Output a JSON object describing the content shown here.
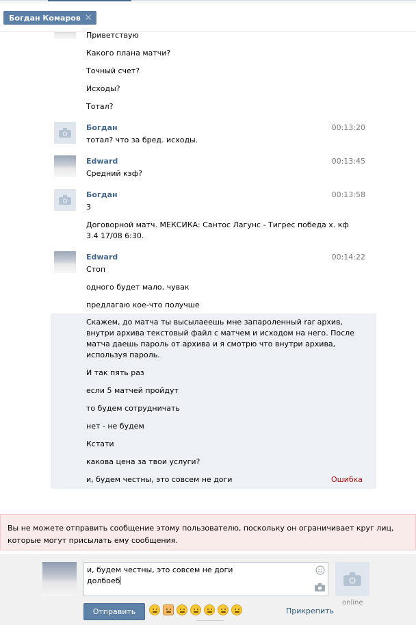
{
  "tab": {
    "title": "Богдан Комаров",
    "close": "✕"
  },
  "messages": [
    {
      "lines": [
        "Приветствую",
        "Какого плана матчи?",
        "Точный счет?",
        "Исходы?",
        "Тотал?"
      ]
    },
    {
      "author": "Богдан",
      "time": "00:13:20",
      "avatar": "camera",
      "lines": [
        "тотал? что за бред. исходы."
      ]
    },
    {
      "author": "Edward",
      "time": "00:13:45",
      "avatar": "photo",
      "lines": [
        "Средний кэф?"
      ]
    },
    {
      "author": "Богдан",
      "time": "00:13:58",
      "avatar": "camera",
      "lines": [
        "3",
        "Договорной матч. МЕКСИКА: Сантос Лагунс - Тигрес победа х. кф",
        "3.4 17/08 6:30."
      ]
    },
    {
      "author": "Edward",
      "time": "00:14:22",
      "avatar": "photo",
      "lines": [
        "Стоп",
        "одного будет мало, чувак",
        "предлагаю кое-что получше"
      ]
    },
    {
      "unread": true,
      "lines": [
        "Скажем, до матча ты высылаеешь мне запароленный rar архив,",
        "внутри архива текстовый файл с матчем и исходом на него. После",
        "матча даешь пароль от архива и я смотрю что внутри архива,",
        "используя пароль.",
        "И так пять раз",
        "если 5 матчей пройдут",
        "то будем сотрудничать",
        "нет - не будем",
        "Кстати",
        "какова цена за твои услуги?",
        "и, будем честны, это совсем не доги"
      ],
      "error": "Ошибка"
    }
  ],
  "warning": "Вы не можете отправить сообщение этому пользователю, поскольку он ограничивает круг лиц, которые могут присылать ему сообщения.",
  "composer": {
    "lines": [
      "и, будем честны, это совсем не доги",
      "долбоеб"
    ],
    "send_label": "Отправить",
    "attach_label": "Прикрепить",
    "status": "online"
  },
  "colors": {
    "link": "#45688e",
    "button": "#5e81a8",
    "error": "#b21111",
    "warning_bg": "#faebeb"
  }
}
